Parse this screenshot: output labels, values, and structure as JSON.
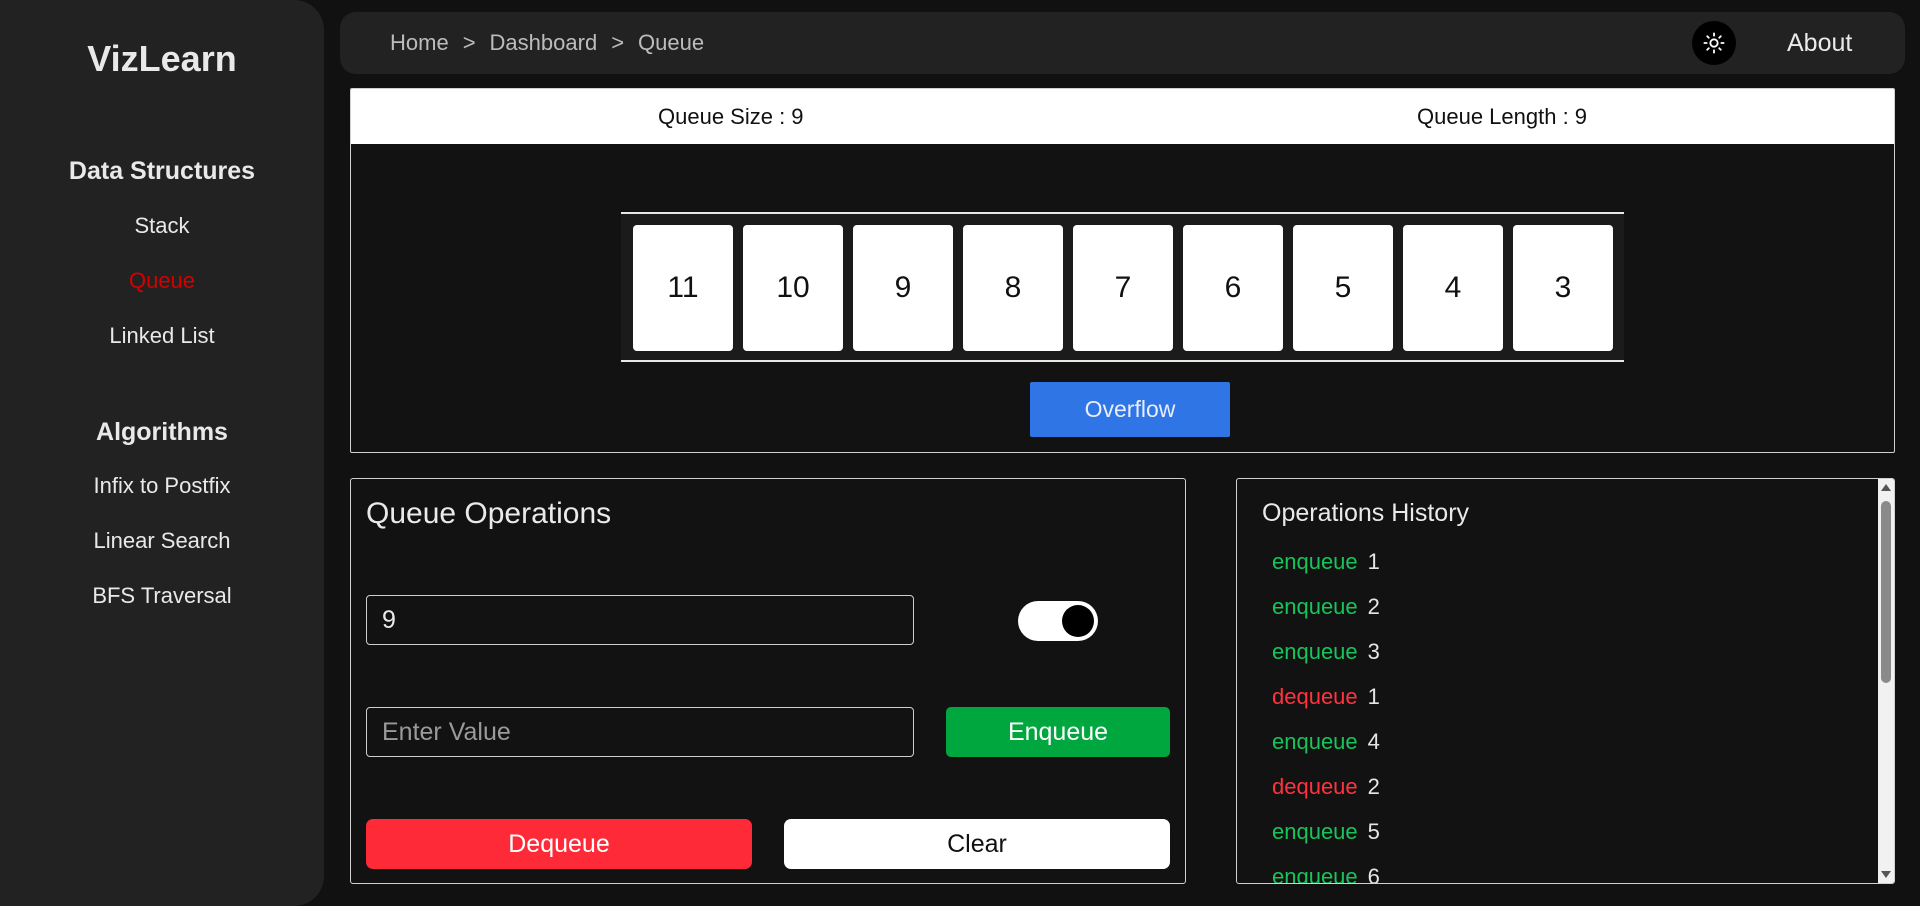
{
  "app": {
    "brand": "VizLearn"
  },
  "sidebar": {
    "sections": [
      {
        "title": "Data Structures",
        "items": [
          {
            "label": "Stack",
            "active": false
          },
          {
            "label": "Queue",
            "active": true
          },
          {
            "label": "Linked List",
            "active": false
          }
        ]
      },
      {
        "title": "Algorithms",
        "items": [
          {
            "label": "Infix to Postfix",
            "active": false
          },
          {
            "label": "Linear Search",
            "active": false
          },
          {
            "label": "BFS Traversal",
            "active": false
          }
        ]
      }
    ]
  },
  "topbar": {
    "breadcrumb": [
      "Home",
      "Dashboard",
      "Queue"
    ],
    "separator": ">",
    "theme_icon": "sun-icon",
    "about_label": "About"
  },
  "queue_panel": {
    "size_label": "Queue Size : 9",
    "length_label": "Queue Length : 9",
    "items": [
      "11",
      "10",
      "9",
      "8",
      "7",
      "6",
      "5",
      "4",
      "3"
    ],
    "status_button": "Overflow"
  },
  "operations": {
    "title": "Queue Operations",
    "size_input_value": "9",
    "toggle_on": true,
    "value_input_placeholder": "Enter Value",
    "enqueue_label": "Enqueue",
    "dequeue_label": "Dequeue",
    "clear_label": "Clear"
  },
  "history": {
    "title": "Operations History",
    "entries": [
      {
        "op": "enqueue",
        "value": "1"
      },
      {
        "op": "enqueue",
        "value": "2"
      },
      {
        "op": "enqueue",
        "value": "3"
      },
      {
        "op": "dequeue",
        "value": "1"
      },
      {
        "op": "enqueue",
        "value": "4"
      },
      {
        "op": "dequeue",
        "value": "2"
      },
      {
        "op": "enqueue",
        "value": "5"
      },
      {
        "op": "enqueue",
        "value": "6"
      }
    ]
  },
  "colors": {
    "accent_active": "#d40000",
    "enqueue": "#00a63e",
    "dequeue": "#ff2a38",
    "overflow": "#2f75e5"
  }
}
